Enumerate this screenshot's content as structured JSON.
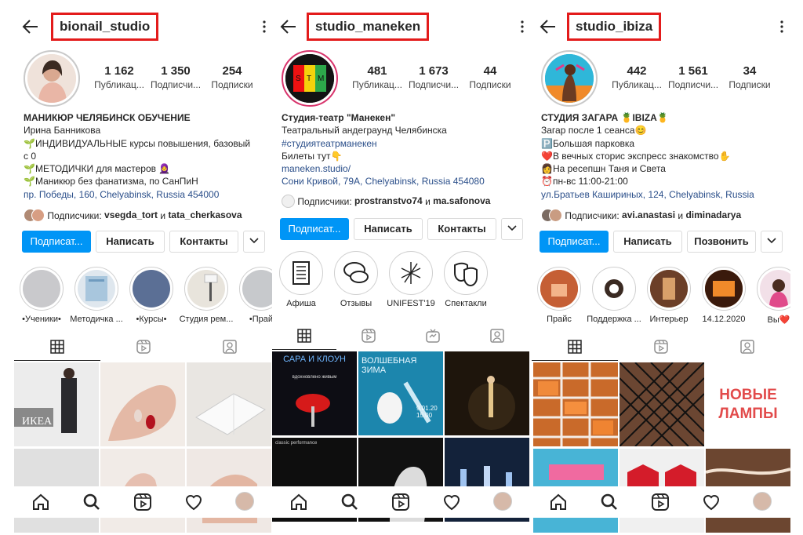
{
  "profiles": [
    {
      "username": "bionail_studio",
      "stats": [
        {
          "value": "1 162",
          "label": "Публикац..."
        },
        {
          "value": "1 350",
          "label": "Подписчи..."
        },
        {
          "value": "254",
          "label": "Подписки"
        }
      ],
      "bio": [
        {
          "text": "МАНИКЮР ЧЕЛЯБИНСК ОБУЧЕНИЕ",
          "style": "bold"
        },
        {
          "text": "Ирина Банникова",
          "style": "normal"
        },
        {
          "text": "🌱ИНДИВИДУАЛЬНЫЕ курсы повышения, базовый",
          "style": "normal"
        },
        {
          "text": "с 0",
          "style": "normal"
        },
        {
          "text": "🌱МЕТОДИЧКИ для мастеров 🧕",
          "style": "normal"
        },
        {
          "text": "🌱Маникюр без фанатизма, по СанПиН",
          "style": "normal"
        },
        {
          "text": "пр. Победы, 160, Chelyabinsk, Russia 454000",
          "style": "link"
        }
      ],
      "followers": {
        "prefix": "Подписчики: ",
        "user1": "vsegda_tort",
        "conj": " и ",
        "user2": "tata_cherkasova"
      },
      "buttons": [
        "Подписат...",
        "Написать",
        "Контакты"
      ],
      "highlights": [
        "•Ученики•",
        "Методичка ...",
        "•Курсы•",
        "Студия рем...",
        "•Прай"
      ]
    },
    {
      "username": "studio_maneken",
      "stats": [
        {
          "value": "481",
          "label": "Публикац..."
        },
        {
          "value": "1 673",
          "label": "Подписчи..."
        },
        {
          "value": "44",
          "label": "Подписки"
        }
      ],
      "bio": [
        {
          "text": "Студия-театр \"Манекен\"",
          "style": "bold"
        },
        {
          "text": "Театральный андеграунд Челябинска",
          "style": "normal"
        },
        {
          "text": "#студиятеатрманекен",
          "style": "link"
        },
        {
          "text": "Билеты тут👇",
          "style": "normal"
        },
        {
          "text": "maneken.studio/",
          "style": "link"
        },
        {
          "text": "Сони Кривой, 79А, Chelyabinsk, Russia 454080",
          "style": "link"
        }
      ],
      "followers": {
        "prefix": "Подписчики: ",
        "user1": "prostranstvo74",
        "conj": " и ",
        "user2": "ma.safonova"
      },
      "buttons": [
        "Подписат...",
        "Написать",
        "Контакты"
      ],
      "highlights": [
        "Афиша",
        "Отзывы",
        "UNIFEST'19",
        "Спектакли"
      ]
    },
    {
      "username": "studio_ibiza",
      "stats": [
        {
          "value": "442",
          "label": "Публикац..."
        },
        {
          "value": "1 561",
          "label": "Подписчи..."
        },
        {
          "value": "34",
          "label": "Подписки"
        }
      ],
      "bio": [
        {
          "text": "СТУДИЯ ЗАГАРА 🍍IBIZA🍍",
          "style": "bold"
        },
        {
          "text": "Загар после 1 сеанса😊",
          "style": "normal"
        },
        {
          "text": "🅿️Большая парковка",
          "style": "normal"
        },
        {
          "text": "❤️В вечных сторис экспресс знакомство✋",
          "style": "normal"
        },
        {
          "text": "👩На ресепшн Таня и Света",
          "style": "normal"
        },
        {
          "text": "⏰пн-вс 11:00-21:00",
          "style": "normal"
        },
        {
          "text": "ул.Братьев Кашириных, 124, Chelyabinsk, Russia",
          "style": "link"
        }
      ],
      "followers": {
        "prefix": "Подписчики: ",
        "user1": "avi.anastasi",
        "conj": " и ",
        "user2": "diminadarya"
      },
      "buttons": [
        "Подписат...",
        "Написать",
        "Позвонить"
      ],
      "highlights": [
        "Прайс",
        "Поддержка ...",
        "Интерьер",
        "14.12.2020",
        "Вы❤️"
      ]
    }
  ],
  "post_text": {
    "ikea": "ИКЕА",
    "sara_title": "САРА И КЛОУН",
    "sara_sub": "вдохновлено живым",
    "moomin_title": "ВОЛШЕБНАЯ ЗИМА",
    "moomin_date": "9.01.20 15:00",
    "classic": "classic performance",
    "new_lamps_1": "НОВЫЕ",
    "new_lamps_2": "ЛАМПЫ"
  },
  "colors": {
    "follow_button": "#0095f6",
    "username_highlight_border": "#e31b1b",
    "link": "#2b4f8a"
  },
  "icons": {
    "topbar": [
      "back-arrow-icon",
      "more-options-icon"
    ],
    "tabs": [
      "grid-icon",
      "reels-icon",
      "igtv-icon",
      "tagged-icon"
    ],
    "nav": [
      "home-icon",
      "search-icon",
      "reels-icon",
      "heart-icon",
      "profile-avatar"
    ]
  }
}
